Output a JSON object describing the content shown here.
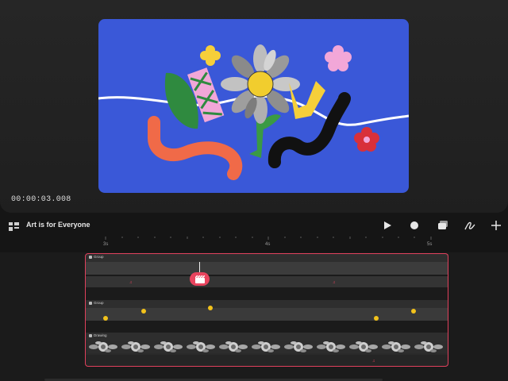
{
  "preview": {
    "timecode": "00:00:03.008"
  },
  "header": {
    "project_title": "Art is for Everyone",
    "icons": [
      "layers-icon",
      "play-icon",
      "record-icon",
      "stack-icon",
      "draw-icon",
      "add-icon"
    ]
  },
  "ruler": {
    "labels": [
      "3s",
      "4s",
      "5s"
    ]
  },
  "tracks": [
    {
      "label": "Group"
    },
    {
      "label": "Group"
    },
    {
      "label": "Drawing"
    }
  ],
  "colors": {
    "canvas_bg": "#3a58d8",
    "accent": "#e8445e",
    "keyframe": "#f2c21b"
  }
}
